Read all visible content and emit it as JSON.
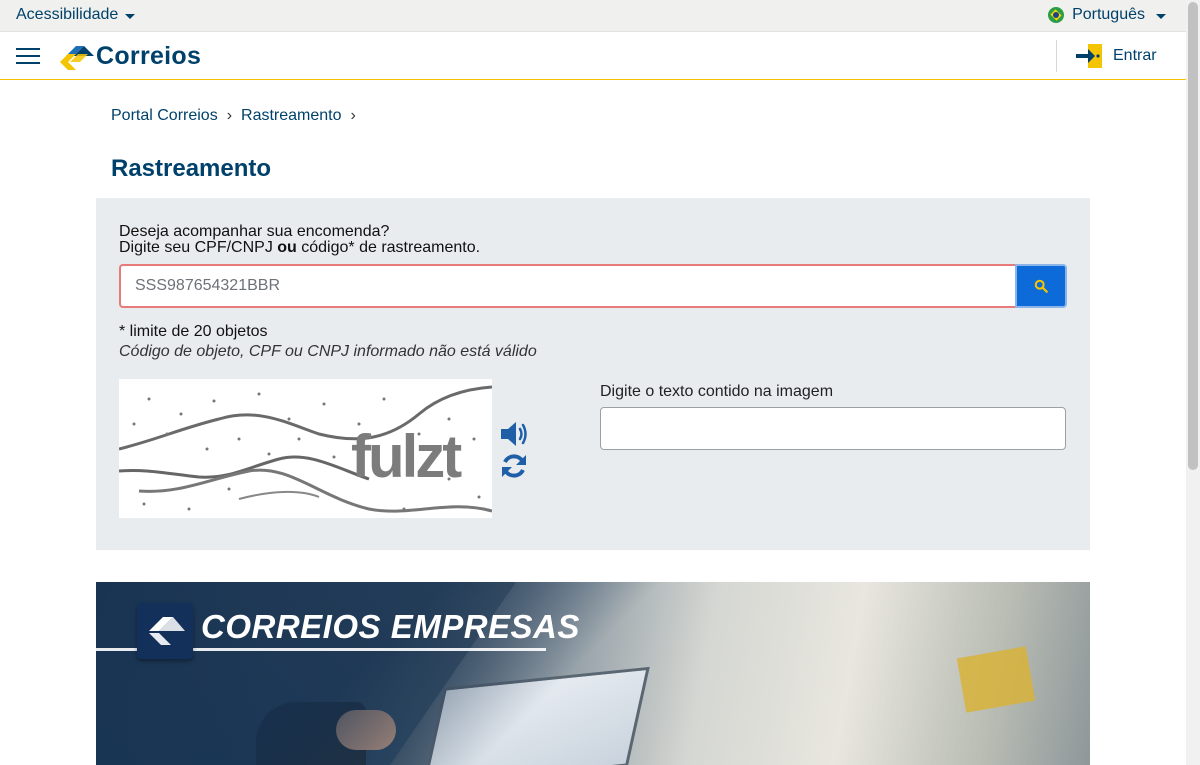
{
  "topbar": {
    "accessibility_label": "Acessibilidade",
    "language_label": "Português"
  },
  "header": {
    "logo_text": "Correios",
    "login_label": "Entrar"
  },
  "breadcrumb": {
    "items": [
      "Portal Correios",
      "Rastreamento"
    ]
  },
  "page": {
    "title": "Rastreamento"
  },
  "tracking": {
    "intro_line1": "Deseja acompanhar sua encomenda?",
    "intro_line2_prefix": "Digite seu CPF/CNPJ ",
    "intro_line2_bold": "ou",
    "intro_line2_suffix": " código* de rastreamento.",
    "input_value": "SSS987654321BBR",
    "limit_note": "* limite de 20 objetos",
    "error_message": "Código de objeto, CPF ou CNPJ informado não está válido"
  },
  "captcha": {
    "text": "fulzt",
    "input_label": "Digite o texto contido na imagem",
    "input_value": ""
  },
  "banner": {
    "title": "CORREIOS EMPRESAS"
  },
  "colors": {
    "brand_blue": "#00416b",
    "brand_yellow": "#f5c400",
    "search_button": "#0d6ad9",
    "error_border": "#e87a7a"
  }
}
